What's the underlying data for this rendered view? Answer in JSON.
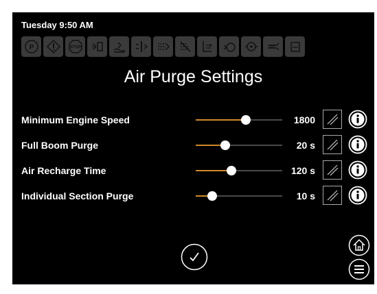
{
  "header": {
    "datetime": "Tuesday 9:50 AM"
  },
  "toolbar_icons": [
    "parking-brake-icon",
    "warning-icon",
    "stop-icon",
    "spray-nozzle-icon",
    "boom-level-icon",
    "section-control-icon",
    "boom-flow-icon",
    "disabled-flow-icon",
    "tank-level-icon",
    "pump-icon",
    "flow-meter-icon",
    "agitation-icon",
    "rinse-icon"
  ],
  "page": {
    "title": "Air Purge Settings"
  },
  "settings": [
    {
      "label": "Minimum Engine Speed",
      "value": "1800",
      "level": 0.58
    },
    {
      "label": "Full Boom Purge",
      "value": "20 s",
      "level": 0.34
    },
    {
      "label": "Air Recharge Time",
      "value": "120 s",
      "level": 0.41
    },
    {
      "label": "Individual Section Purge",
      "value": "10 s",
      "level": 0.19
    }
  ],
  "colors": {
    "background": "#000000",
    "accent": "#d08a2a",
    "icon_bg": "#3a3a3a",
    "text": "#ffffff"
  }
}
